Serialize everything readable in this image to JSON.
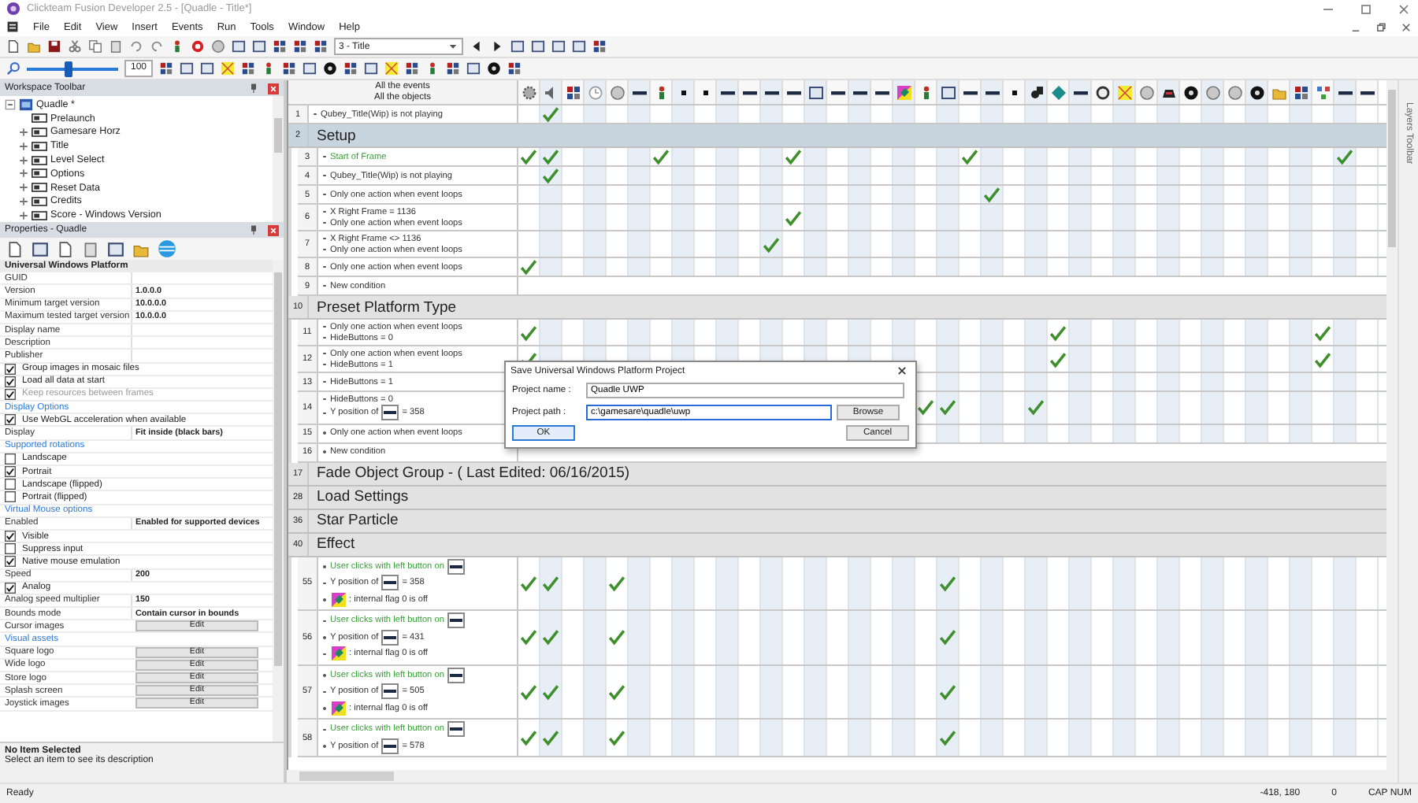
{
  "window": {
    "title": "Clickteam Fusion Developer 2.5 - [Quadle - Title*]"
  },
  "menu": [
    "File",
    "Edit",
    "View",
    "Insert",
    "Events",
    "Run",
    "Tools",
    "Window",
    "Help"
  ],
  "toolbar": {
    "frame_select": "3 - Title",
    "zoom": {
      "value": "100",
      "level": 0.45
    }
  },
  "workspace": {
    "title": "Workspace Toolbar",
    "tree": [
      {
        "label": "Quadle *",
        "expanded": true,
        "children": [
          {
            "label": "Prelaunch",
            "kind": "leaf"
          },
          {
            "label": "Gamesare Horz",
            "kind": "frame"
          },
          {
            "label": "Title",
            "kind": "frame"
          },
          {
            "label": "Level Select",
            "kind": "frame"
          },
          {
            "label": "Options",
            "kind": "frame"
          },
          {
            "label": "Reset Data",
            "kind": "frame"
          },
          {
            "label": "Credits",
            "kind": "frame"
          },
          {
            "label": "Score - Windows Version",
            "kind": "frame"
          }
        ]
      }
    ]
  },
  "properties": {
    "title": "Properties - Quadle",
    "rows": [
      {
        "kind": "section",
        "label": "Universal Windows Platform"
      },
      {
        "kind": "field",
        "label": "GUID"
      },
      {
        "kind": "field",
        "label": "Version",
        "value": "1.0.0.0"
      },
      {
        "kind": "field",
        "label": "Minimum target version",
        "value": "10.0.0.0"
      },
      {
        "kind": "field",
        "label": "Maximum tested target version",
        "value": "10.0.0.0"
      },
      {
        "kind": "field",
        "label": "Display name"
      },
      {
        "kind": "field",
        "label": "Description"
      },
      {
        "kind": "field",
        "label": "Publisher"
      },
      {
        "kind": "check",
        "label": "Group images in mosaic files",
        "checked": true,
        "disabled": false
      },
      {
        "kind": "check",
        "label": "Load all data at start",
        "checked": true,
        "disabled": false
      },
      {
        "kind": "check",
        "label": "Keep resources between frames",
        "checked": true,
        "disabled": true
      },
      {
        "kind": "heading",
        "label": "Display Options"
      },
      {
        "kind": "check",
        "label": "Use WebGL acceleration when available",
        "checked": true,
        "disabled": false
      },
      {
        "kind": "field",
        "label": "Display",
        "value": "Fit inside (black bars)"
      },
      {
        "kind": "heading",
        "label": "Supported rotations"
      },
      {
        "kind": "check",
        "label": "Landscape",
        "checked": false,
        "disabled": false
      },
      {
        "kind": "check",
        "label": "Portrait",
        "checked": true,
        "disabled": false
      },
      {
        "kind": "check",
        "label": "Landscape (flipped)",
        "checked": false,
        "disabled": false
      },
      {
        "kind": "check",
        "label": "Portrait (flipped)",
        "checked": false,
        "disabled": false
      },
      {
        "kind": "heading",
        "label": "Virtual Mouse options"
      },
      {
        "kind": "field",
        "label": "Enabled",
        "value": "Enabled for supported devices"
      },
      {
        "kind": "check",
        "label": "Visible",
        "checked": true,
        "disabled": false
      },
      {
        "kind": "check",
        "label": "Suppress input",
        "checked": false,
        "disabled": false
      },
      {
        "kind": "check",
        "label": "Native mouse emulation",
        "checked": true,
        "disabled": false
      },
      {
        "kind": "field",
        "label": "Speed",
        "value": "200"
      },
      {
        "kind": "check",
        "label": "Analog",
        "checked": true,
        "disabled": false
      },
      {
        "kind": "field",
        "label": "Analog speed multiplier",
        "value": "150"
      },
      {
        "kind": "field",
        "label": "Bounds mode",
        "value": "Contain cursor in bounds"
      },
      {
        "kind": "button",
        "label": "Cursor images",
        "button": "Edit"
      },
      {
        "kind": "heading",
        "label": "Visual assets"
      },
      {
        "kind": "button",
        "label": "Square logo",
        "button": "Edit"
      },
      {
        "kind": "button",
        "label": "Wide logo",
        "button": "Edit"
      },
      {
        "kind": "button",
        "label": "Store logo",
        "button": "Edit"
      },
      {
        "kind": "button",
        "label": "Splash screen",
        "button": "Edit"
      },
      {
        "kind": "button",
        "label": "Joystick images",
        "button": "Edit"
      }
    ],
    "description": {
      "title": "No Item Selected",
      "text": "Select an item to see its description"
    }
  },
  "events": {
    "header": [
      "All the events",
      "All the objects"
    ],
    "rows": [
      {
        "kind": "event",
        "number": "1",
        "conditions": [
          {
            "kind": "plain",
            "text": "Qubey_Title(Wip) is not playing"
          }
        ],
        "checks": [
          false,
          true
        ]
      },
      {
        "kind": "group",
        "number": "2",
        "title": "Setup",
        "selected": true,
        "children": [
          {
            "kind": "event",
            "number": "3",
            "conditions": [
              {
                "kind": "trigger",
                "text": "Start of Frame"
              }
            ],
            "checks": [
              true,
              true,
              false,
              false,
              false,
              false,
              true,
              false,
              false,
              false,
              false,
              false,
              true,
              false,
              false,
              false,
              false,
              false,
              false,
              false,
              true,
              false,
              false,
              false,
              false,
              false,
              false,
              false,
              false,
              false,
              false,
              false,
              false,
              false,
              false,
              false,
              false,
              true
            ]
          },
          {
            "kind": "event",
            "number": "4",
            "conditions": [
              {
                "kind": "plain",
                "text": "Qubey_Title(Wip) is not playing"
              }
            ],
            "checks": [
              false,
              true
            ]
          },
          {
            "kind": "event",
            "number": "5",
            "conditions": [
              {
                "kind": "plain",
                "text": "Only one action when event loops"
              }
            ],
            "checks": [
              false,
              false,
              false,
              false,
              false,
              false,
              false,
              false,
              false,
              false,
              false,
              false,
              false,
              false,
              false,
              false,
              false,
              false,
              false,
              false,
              false,
              true
            ]
          },
          {
            "kind": "event",
            "number": "6",
            "conditions": [
              {
                "kind": "plain",
                "text": "X Right Frame = 1136"
              },
              {
                "kind": "plain",
                "text": "Only one action when event loops"
              }
            ],
            "checks": [
              false,
              false,
              false,
              false,
              false,
              false,
              false,
              false,
              false,
              false,
              false,
              false,
              true
            ]
          },
          {
            "kind": "event",
            "number": "7",
            "conditions": [
              {
                "kind": "plain",
                "text": "X Right Frame <> 1136"
              },
              {
                "kind": "plain",
                "text": "Only one action when event loops"
              }
            ],
            "checks": [
              false,
              false,
              false,
              false,
              false,
              false,
              false,
              false,
              false,
              false,
              false,
              true
            ]
          },
          {
            "kind": "event",
            "number": "8",
            "conditions": [
              {
                "kind": "plain",
                "text": "Only one action when event loops"
              }
            ],
            "checks": [
              true
            ]
          },
          {
            "kind": "new",
            "number": "9",
            "conditions": [
              {
                "kind": "plain",
                "text": "New condition"
              }
            ]
          }
        ]
      },
      {
        "kind": "group",
        "number": "10",
        "title": "Preset Platform Type",
        "selected": false,
        "children": [
          {
            "kind": "event",
            "number": "11",
            "conditions": [
              {
                "kind": "plain",
                "text": "Only one action when event loops"
              },
              {
                "kind": "plain",
                "text": "HideButtons = 0"
              }
            ],
            "checks": [
              true,
              false,
              false,
              false,
              false,
              false,
              false,
              false,
              false,
              false,
              false,
              false,
              false,
              false,
              false,
              false,
              false,
              false,
              false,
              false,
              false,
              false,
              false,
              false,
              true,
              false,
              false,
              false,
              false,
              false,
              false,
              false,
              false,
              false,
              false,
              false,
              true
            ]
          },
          {
            "kind": "event",
            "number": "12",
            "conditions": [
              {
                "kind": "plain",
                "text": "Only one action when event loops"
              },
              {
                "kind": "plain",
                "text": "HideButtons = 1"
              }
            ],
            "checks": [
              true,
              false,
              false,
              false,
              false,
              false,
              false,
              false,
              false,
              false,
              false,
              false,
              false,
              false,
              false,
              false,
              false,
              false,
              false,
              false,
              false,
              false,
              false,
              false,
              true,
              false,
              false,
              false,
              false,
              false,
              false,
              false,
              false,
              false,
              false,
              false,
              true
            ]
          },
          {
            "kind": "event",
            "number": "13",
            "conditions": [
              {
                "kind": "plain",
                "text": "HideButtons = 1"
              }
            ]
          },
          {
            "kind": "event",
            "number": "14",
            "conditions": [
              {
                "kind": "plain",
                "text": "HideButtons = 0"
              },
              {
                "kind": "position",
                "text": "Y position of",
                "after": "= 358"
              }
            ],
            "checks": [
              false,
              false,
              false,
              false,
              false,
              false,
              false,
              false,
              false,
              false,
              false,
              false,
              false,
              false,
              false,
              false,
              false,
              false,
              true,
              true,
              false,
              false,
              false,
              true
            ]
          },
          {
            "kind": "event",
            "number": "15",
            "conditions": [
              {
                "kind": "plain",
                "text": "Only one action when event loops"
              }
            ]
          },
          {
            "kind": "new",
            "number": "16",
            "conditions": [
              {
                "kind": "plain",
                "text": "New condition"
              }
            ]
          }
        ]
      },
      {
        "kind": "group",
        "number": "17",
        "title": "Fade Object Group - ( Last Edited: 06/16/2015)",
        "selected": false
      },
      {
        "kind": "group",
        "number": "28",
        "title": "Load Settings",
        "selected": false
      },
      {
        "kind": "group",
        "number": "36",
        "title": "Star Particle",
        "selected": false
      },
      {
        "kind": "group",
        "number": "40",
        "title": "Effect",
        "selected": false,
        "children": [
          {
            "kind": "event",
            "number": "55",
            "conditions": [
              {
                "kind": "click",
                "text": "User clicks with left button on"
              },
              {
                "kind": "position",
                "text": "Y position of",
                "after": "= 358"
              },
              {
                "kind": "flag",
                "after": ": internal flag 0 is off"
              }
            ],
            "checks": [
              true,
              true,
              false,
              false,
              true,
              false,
              false,
              false,
              false,
              false,
              false,
              false,
              false,
              false,
              false,
              false,
              false,
              false,
              false,
              true
            ]
          },
          {
            "kind": "event",
            "number": "56",
            "conditions": [
              {
                "kind": "click",
                "text": "User clicks with left button on"
              },
              {
                "kind": "position",
                "text": "Y position of",
                "after": "= 431"
              },
              {
                "kind": "flag",
                "after": ": internal flag 0 is off"
              }
            ],
            "checks": [
              true,
              true,
              false,
              false,
              true,
              false,
              false,
              false,
              false,
              false,
              false,
              false,
              false,
              false,
              false,
              false,
              false,
              false,
              false,
              true
            ]
          },
          {
            "kind": "event",
            "number": "57",
            "conditions": [
              {
                "kind": "click",
                "text": "User clicks with left button on"
              },
              {
                "kind": "position",
                "text": "Y position of",
                "after": "= 505"
              },
              {
                "kind": "flag",
                "after": ": internal flag 0 is off"
              }
            ],
            "checks": [
              true,
              true,
              false,
              false,
              true,
              false,
              false,
              false,
              false,
              false,
              false,
              false,
              false,
              false,
              false,
              false,
              false,
              false,
              false,
              true
            ]
          },
          {
            "kind": "event",
            "number": "58",
            "conditions": [
              {
                "kind": "click",
                "text": "User clicks with left button on"
              },
              {
                "kind": "position",
                "text": "Y position of",
                "after": "= 578"
              }
            ],
            "checks": [
              true,
              true,
              false,
              false,
              true,
              false,
              false,
              false,
              false,
              false,
              false,
              false,
              false,
              false,
              false,
              false,
              false,
              false,
              false,
              true
            ]
          }
        ]
      }
    ]
  },
  "dialog": {
    "title": "Save Universal Windows Platform Project",
    "fields": [
      {
        "label": "Project name :",
        "value": "Quadle UWP"
      },
      {
        "label": "Project path :",
        "value": "c:\\gamesare\\quadle\\uwp",
        "button": "Browse"
      }
    ],
    "ok": "OK",
    "cancel": "Cancel"
  },
  "layers_toolbar": "Layers Toolbar",
  "status_bar": {
    "text": "Ready",
    "coords": "-418, 180",
    "value": "0",
    "keys": "CAP NUM"
  }
}
